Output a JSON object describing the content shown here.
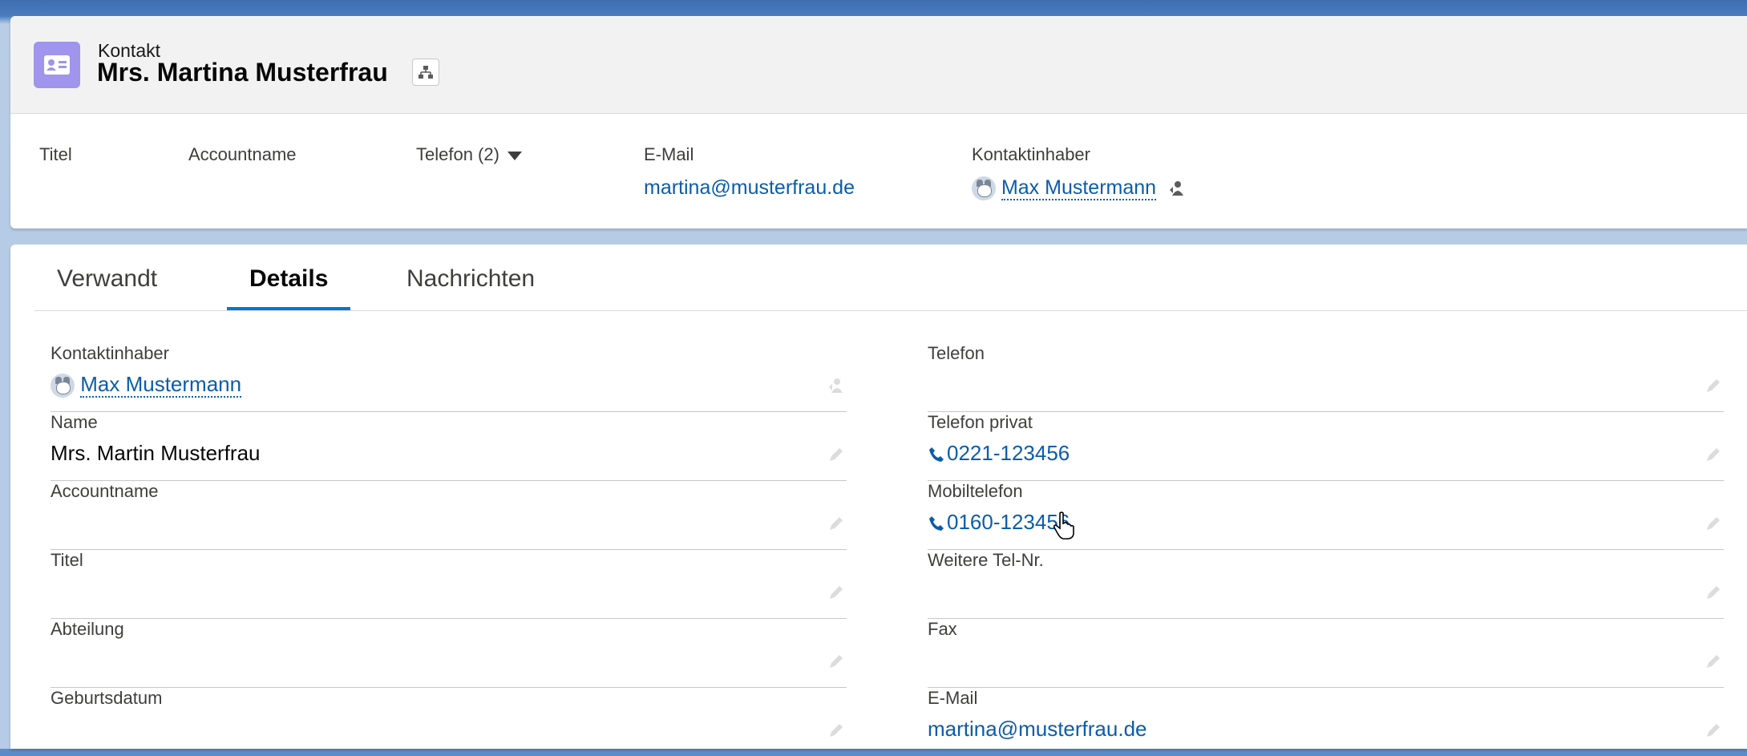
{
  "header": {
    "object_label": "Kontakt",
    "record_title": "Mrs. Martina Musterfrau",
    "icon": "contact-card-icon",
    "hierarchy_icon": "hierarchy-icon",
    "highlights": {
      "title_label": "Titel",
      "account_label": "Accountname",
      "phone_label": "Telefon (2)",
      "email_label": "E-Mail",
      "email_value": "martina@musterfrau.de",
      "owner_label": "Kontaktinhaber",
      "owner_value": "Max Mustermann"
    }
  },
  "tabs": [
    {
      "label": "Verwandt",
      "active": false
    },
    {
      "label": "Details",
      "active": true
    },
    {
      "label": "Nachrichten",
      "active": false
    }
  ],
  "details": {
    "left": [
      {
        "label": "Kontaktinhaber",
        "value": "Max Mustermann"
      },
      {
        "label": "Name",
        "value": "Mrs. Martin Musterfrau"
      },
      {
        "label": "Accountname",
        "value": ""
      },
      {
        "label": "Titel",
        "value": ""
      },
      {
        "label": "Abteilung",
        "value": ""
      },
      {
        "label": "Geburtsdatum",
        "value": ""
      }
    ],
    "right": [
      {
        "label": "Telefon",
        "value": ""
      },
      {
        "label": "Telefon privat",
        "value": "0221-123456"
      },
      {
        "label": "Mobiltelefon",
        "value": "0160-123456"
      },
      {
        "label": "Weitere Tel-Nr.",
        "value": ""
      },
      {
        "label": "Fax",
        "value": ""
      },
      {
        "label": "E-Mail",
        "value": "martina@musterfrau.de"
      }
    ]
  },
  "colors": {
    "link": "#0b5cab",
    "contact_icon_bg": "#a094ed",
    "active_tab": "#0176d3"
  }
}
